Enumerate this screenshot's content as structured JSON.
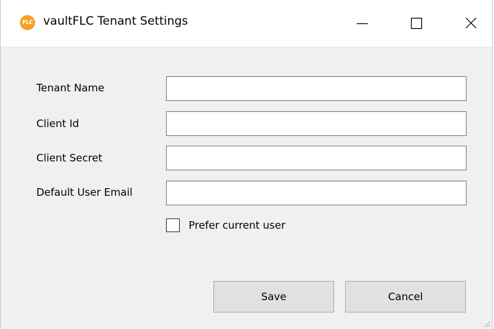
{
  "window": {
    "title": "vaultFLC Tenant Settings",
    "icon_text": "FLC",
    "icon_color": "#f6a020"
  },
  "title_buttons": [
    "minimize-icon",
    "maximize-icon",
    "close-icon"
  ],
  "form": {
    "tenant_name": {
      "label": "Tenant Name",
      "value": ""
    },
    "client_id": {
      "label": "Client Id",
      "value": ""
    },
    "client_secret": {
      "label": "Client Secret",
      "value": ""
    },
    "default_user_email": {
      "label": "Default User Email",
      "value": ""
    },
    "prefer_current_user": {
      "label": "Prefer current user",
      "checked": false
    }
  },
  "buttons": {
    "save": "Save",
    "cancel": "Cancel"
  }
}
